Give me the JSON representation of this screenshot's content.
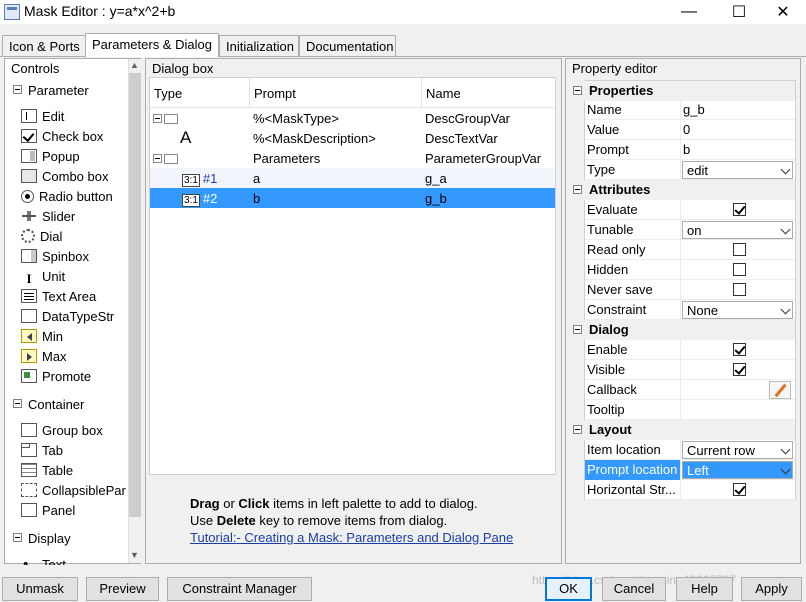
{
  "window": {
    "title": "Mask Editor : y=a*x^2+b",
    "minimize": "—",
    "maximize": "☐",
    "close": "✕"
  },
  "tabs": [
    "Icon & Ports",
    "Parameters & Dialog",
    "Initialization",
    "Documentation"
  ],
  "controls": {
    "heading": "Controls",
    "groups": [
      {
        "label": "Parameter",
        "items": [
          "Edit",
          "Check box",
          "Popup",
          "Combo box",
          "Radio button",
          "Slider",
          "Dial",
          "Spinbox",
          "Unit",
          "Text Area",
          "DataTypeStr",
          "Min",
          "Max",
          "Promote"
        ]
      },
      {
        "label": "Container",
        "items": [
          "Group box",
          "Tab",
          "Table",
          "CollapsiblePar",
          "Panel"
        ]
      },
      {
        "label": "Display",
        "items": [
          "Text"
        ]
      }
    ]
  },
  "dialog_box": {
    "heading": "Dialog box",
    "columns": [
      "Type",
      "Prompt",
      "Name"
    ],
    "rows": [
      {
        "type": "",
        "prompt": "%<MaskType>",
        "name": "DescGroupVar"
      },
      {
        "type": "A",
        "prompt": "%<MaskDescription>",
        "name": "DescTextVar"
      },
      {
        "type": "",
        "prompt": "Parameters",
        "name": "ParameterGroupVar"
      },
      {
        "type": "#1",
        "prompt": "a",
        "name": "g_a"
      },
      {
        "type": "#2",
        "prompt": "b",
        "name": "g_b"
      }
    ],
    "help": {
      "line1_bold1": "Drag",
      "line1_mid": " or ",
      "line1_bold2": "Click",
      "line1_rest": " items in left palette to add to dialog.",
      "line2_a": "Use ",
      "line2_bold": "Delete",
      "line2_b": " key to remove items from dialog.",
      "link": "Tutorial:- Creating a Mask: Parameters and Dialog Pane"
    }
  },
  "property_editor": {
    "heading": "Property editor",
    "sections": {
      "properties": "Properties",
      "attributes": "Attributes",
      "dialog": "Dialog",
      "layout": "Layout"
    },
    "name": {
      "label": "Name",
      "value": "g_b"
    },
    "value": {
      "label": "Value",
      "value": "0"
    },
    "prompt": {
      "label": "Prompt",
      "value": "b"
    },
    "type": {
      "label": "Type",
      "value": "edit"
    },
    "evaluate": {
      "label": "Evaluate",
      "checked": true
    },
    "tunable": {
      "label": "Tunable",
      "value": "on"
    },
    "read_only": {
      "label": "Read only",
      "checked": false
    },
    "hidden": {
      "label": "Hidden",
      "checked": false
    },
    "never_save": {
      "label": "Never save",
      "checked": false
    },
    "constraint": {
      "label": "Constraint",
      "value": "None"
    },
    "enable": {
      "label": "Enable",
      "checked": true
    },
    "visible": {
      "label": "Visible",
      "checked": true
    },
    "callback": {
      "label": "Callback"
    },
    "tooltip": {
      "label": "Tooltip"
    },
    "item_location": {
      "label": "Item location",
      "value": "Current row"
    },
    "prompt_location": {
      "label": "Prompt location",
      "value": "Left"
    },
    "horizontal_stretch": {
      "label": "Horizontal Str...",
      "checked": true
    }
  },
  "buttons": {
    "unmask": "Unmask",
    "preview": "Preview",
    "constraint_manager": "Constraint Manager",
    "ok": "OK",
    "cancel": "Cancel",
    "help": "Help",
    "apply": "Apply"
  },
  "watermark": "https://blog.csdn.net/weixin_43965707",
  "colors": {
    "selection": "#3399ff",
    "link": "#1a3ea8",
    "default_button_border": "#0078d7"
  }
}
